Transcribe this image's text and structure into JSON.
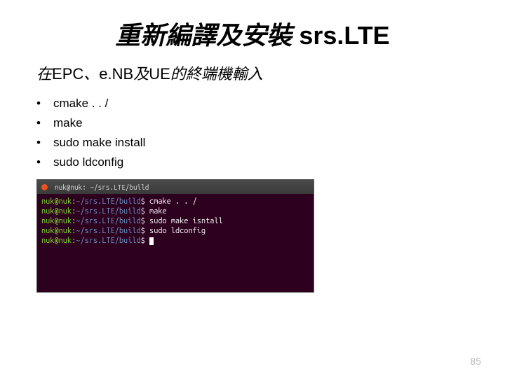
{
  "title": {
    "cjk": "重新編譯及安裝",
    "latin": " srs.LTE"
  },
  "subtitle": {
    "pre": "在",
    "t1": "EPC",
    "sep": "、",
    "t2": "e.NB",
    "mid": "及",
    "t3": "UE",
    "post": "的終端機輸入"
  },
  "commands": [
    "cmake . . /",
    "make",
    "sudo make install",
    "sudo ldconfig"
  ],
  "terminal": {
    "window_title": "nuk@nuk: ~/srs.LTE/build",
    "prompt_user": "nuk@nuk",
    "prompt_path": "~/srs.LTE/build",
    "lines": [
      "cmake . . /",
      "make",
      "sudo make isntall",
      "sudo ldconfig",
      ""
    ]
  },
  "page_number": "85"
}
